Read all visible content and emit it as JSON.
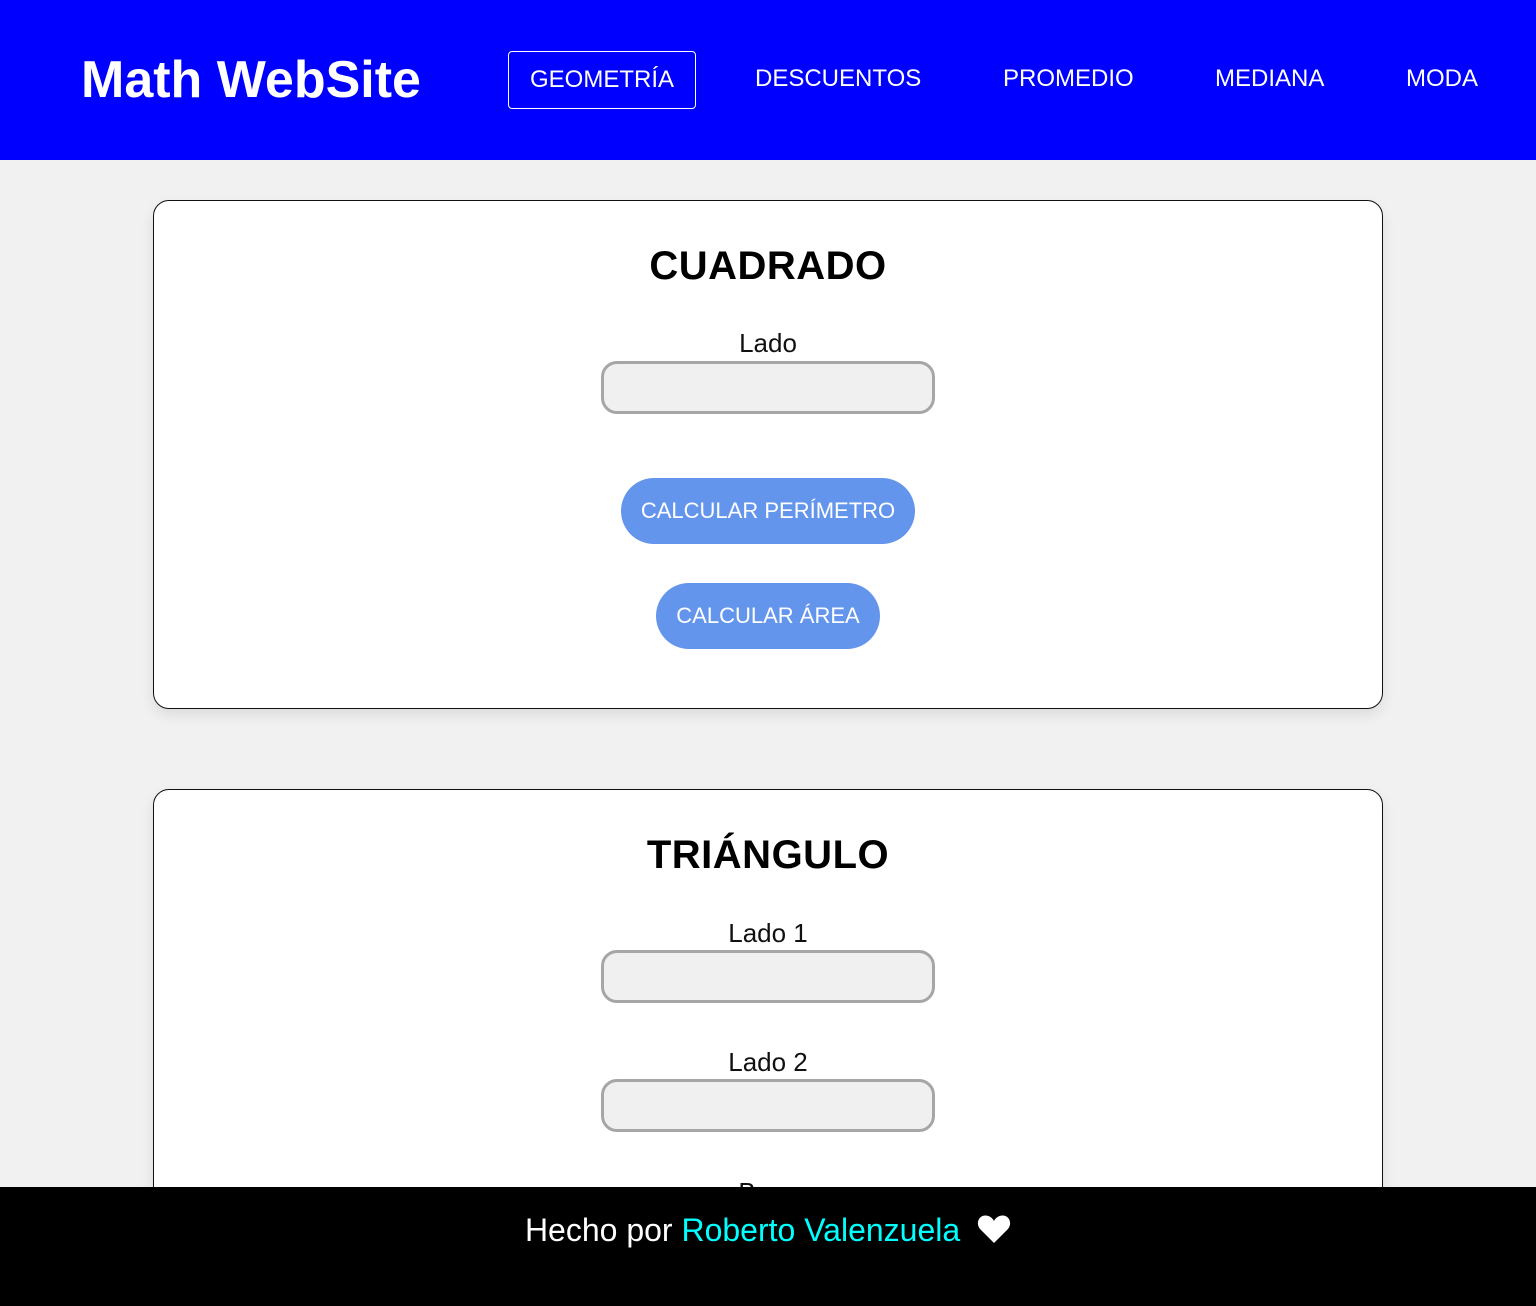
{
  "header": {
    "brand": "Math WebSite",
    "nav": [
      {
        "label": "GEOMETRÍA",
        "active": true
      },
      {
        "label": "DESCUENTOS",
        "active": false
      },
      {
        "label": "PROMEDIO",
        "active": false
      },
      {
        "label": "MEDIANA",
        "active": false
      },
      {
        "label": "MODA",
        "active": false
      }
    ]
  },
  "square": {
    "title": "CUADRADO",
    "side_label": "Lado",
    "side_value": "",
    "perimeter_button": "CALCULAR PERÍMETRO",
    "area_button": "CALCULAR ÁREA"
  },
  "triangle": {
    "title": "TRIÁNGULO",
    "side1_label": "Lado 1",
    "side1_value": "",
    "side2_label": "Lado 2",
    "side2_value": "",
    "base_label": "Base"
  },
  "footer": {
    "made_by": "Hecho por",
    "author": "Roberto Valenzuela",
    "heart_icon": "heart-icon"
  },
  "colors": {
    "header_bg": "#0000ff",
    "page_bg": "#f1f1f1",
    "button_bg": "#6495ed",
    "footer_bg": "#000000",
    "author_link": "#00ffff"
  }
}
